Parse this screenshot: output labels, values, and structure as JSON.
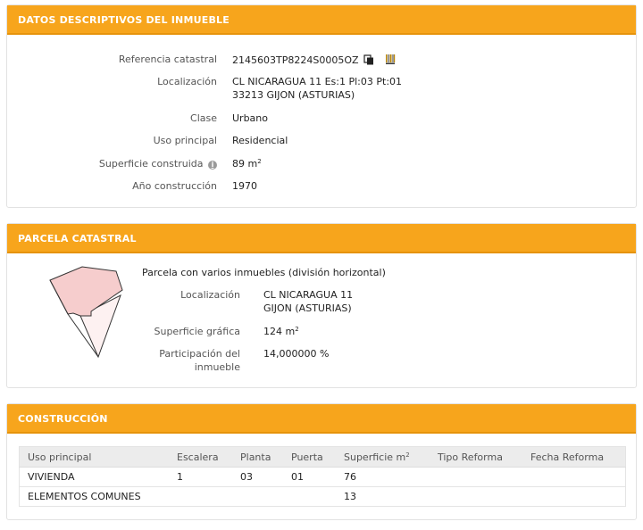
{
  "inmueble": {
    "header": "DATOS DESCRIPTIVOS DEL INMUEBLE",
    "referencia_label": "Referencia catastral",
    "referencia_value": "2145603TP8224S0005OZ",
    "localizacion_label": "Localización",
    "localizacion_line1": "CL NICARAGUA 11 Es:1 Pl:03 Pt:01",
    "localizacion_line2": "33213 GIJON (ASTURIAS)",
    "clase_label": "Clase",
    "clase_value": "Urbano",
    "uso_label": "Uso principal",
    "uso_value": "Residencial",
    "superficie_label": "Superficie construida",
    "superficie_value": "89 m",
    "superficie_unit_sup": "2",
    "anio_label": "Año construcción",
    "anio_value": "1970",
    "info_icon_glyph": "i"
  },
  "parcela": {
    "header": "PARCELA CATASTRAL",
    "title": "Parcela con varios inmuebles (división horizontal)",
    "localizacion_label": "Localización",
    "localizacion_line1": "CL NICARAGUA 11",
    "localizacion_line2": "GIJON (ASTURIAS)",
    "superficie_label": "Superficie gráfica",
    "superficie_value": "124 m",
    "superficie_unit_sup": "2",
    "participacion_label_1": "Participación del",
    "participacion_label_2": "inmueble",
    "participacion_value": "14,000000 %",
    "colors": {
      "fill_main": "#f6cdcd",
      "fill_light": "#fdf1f1",
      "stroke": "#333333"
    }
  },
  "construccion": {
    "header": "CONSTRUCCIÓN",
    "columns": [
      "Uso principal",
      "Escalera",
      "Planta",
      "Puerta",
      "Superficie m",
      "Tipo Reforma",
      "Fecha Reforma"
    ],
    "superficie_col_sup": "2",
    "rows": [
      [
        "VIVIENDA",
        "1",
        "03",
        "01",
        "76",
        "",
        ""
      ],
      [
        "ELEMENTOS COMUNES",
        "",
        "",
        "",
        "13",
        "",
        ""
      ]
    ]
  },
  "colors": {
    "header_bg": "#f7a51c",
    "header_text": "#ffffff"
  }
}
